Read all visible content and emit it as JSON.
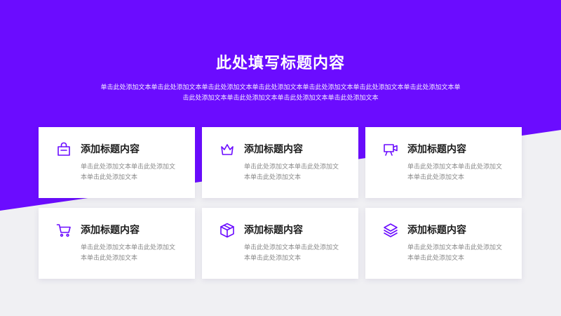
{
  "colors": {
    "accent": "#6b0cff",
    "background": "#f0f0f3",
    "card": "#ffffff"
  },
  "header": {
    "title": "此处填写标题内容",
    "subtitle": "单击此处添加文本单击此处添加文本单击此处添加文本单击此处添加文本单击此处添加文本单击此处添加文本单击此处添加文本单击此处添加文本单击此处添加文本单击此处添加文本单击此处添加文本"
  },
  "cards": [
    {
      "icon": "shopping-bag-icon",
      "title": "添加标题内容",
      "text": "单击此处添加文本单击此处添加文本单击此处添加文本"
    },
    {
      "icon": "crown-icon",
      "title": "添加标题内容",
      "text": "单击此处添加文本单击此处添加文本单击此处添加文本"
    },
    {
      "icon": "presentation-icon",
      "title": "添加标题内容",
      "text": "单击此处添加文本单击此处添加文本单击此处添加文本"
    },
    {
      "icon": "shopping-cart-icon",
      "title": "添加标题内容",
      "text": "单击此处添加文本单击此处添加文本单击此处添加文本"
    },
    {
      "icon": "box-icon",
      "title": "添加标题内容",
      "text": "单击此处添加文本单击此处添加文本单击此处添加文本"
    },
    {
      "icon": "layers-icon",
      "title": "添加标题内容",
      "text": "单击此处添加文本单击此处添加文本单击此处添加文本"
    }
  ]
}
